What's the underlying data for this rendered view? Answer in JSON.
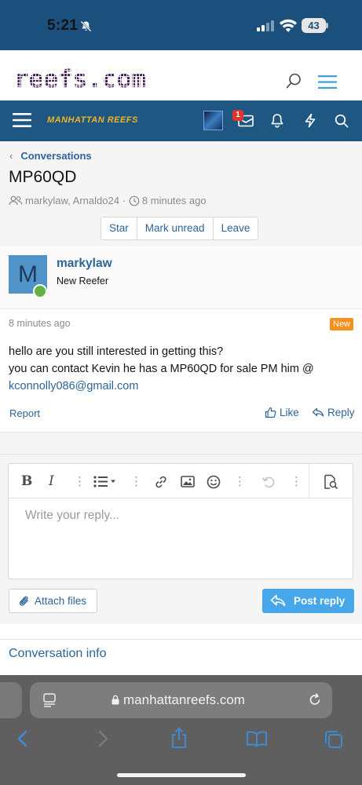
{
  "status_bar": {
    "time": "5:21",
    "battery": "43"
  },
  "site": {
    "logo_text": "reefs.com"
  },
  "nav": {
    "brand": "MANHATTAN REEFS",
    "notification_count": "1"
  },
  "conversation": {
    "breadcrumb": "Conversations",
    "title": "MP60QD",
    "participants": "markylaw, Arnaldo24 ·",
    "started": "8 minutes ago",
    "actions": [
      "Star",
      "Mark unread",
      "Leave"
    ]
  },
  "message": {
    "username": "markylaw",
    "user_title": "New Reefer",
    "avatar_letter": "M",
    "time": "8 minutes ago",
    "badge": "New",
    "body_line1": "hello are you still interested in getting this?",
    "body_line2": "you can contact Kevin he has a MP60QD for sale PM him @",
    "email": "kconnolly086@gmail.com",
    "report": "Report",
    "like": "Like",
    "reply": "Reply"
  },
  "reply_form": {
    "placeholder": "Write your reply...",
    "attach_label": "Attach files",
    "post_label": "Post reply"
  },
  "conversation_info": "Conversation info",
  "browser": {
    "url": "manhattanreefs.com"
  },
  "colors": {
    "status_bar": "#1b4f7c",
    "nav_bar": "#1f5783",
    "link": "#2c6499",
    "new_badge": "#f58f1d",
    "post_button": "#47a7eb",
    "online": "#63b342"
  }
}
